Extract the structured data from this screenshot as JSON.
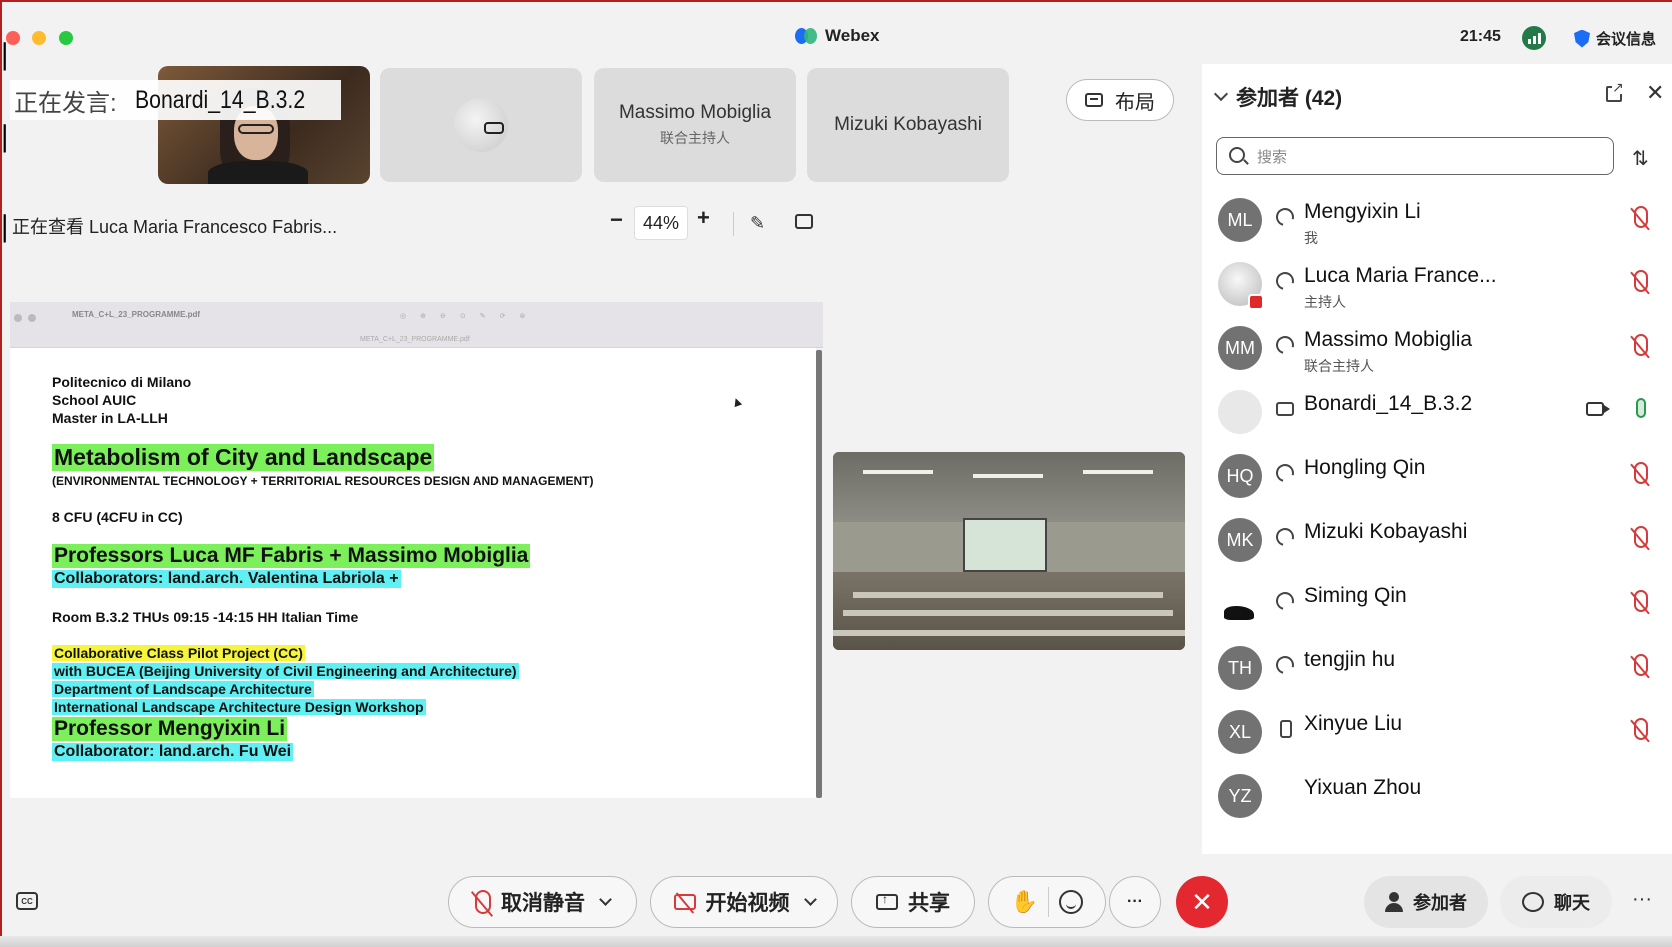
{
  "window": {
    "app_title": "Webex",
    "clock": "21:45",
    "meeting_info": "会议信息"
  },
  "stage": {
    "speaking_prefix": "正在发言:",
    "speaking_name": "Bonardi_14_B.3.2",
    "tiles": [
      {
        "name": "",
        "role": ""
      },
      {
        "name": "Massimo Mobiglia",
        "role": "联合主持人"
      },
      {
        "name": "Mizuki Kobayashi",
        "role": ""
      }
    ],
    "layout_label": "布局",
    "viewing_text": "正在查看 Luca Maria Francesco Fabris...",
    "zoom_minus": "−",
    "zoom_value": "44%",
    "zoom_plus": "+"
  },
  "document": {
    "filename": "META_C+L_23_PROGRAMME.pdf",
    "subtitle": "META_C+L_23_PROGRAMME.pdf",
    "lines": {
      "l1": "Politecnico di Milano",
      "l2": "School AUIC",
      "l3": "Master in LA-LLH",
      "title": "Metabolism of City and Landscape",
      "subtitle": "(ENVIRONMENTAL TECHNOLOGY + TERRITORIAL RESOURCES DESIGN AND MANAGEMENT)",
      "cfu": "8 CFU (4CFU in CC)",
      "professors": "Professors Luca MF Fabris + Massimo Mobiglia",
      "collab1": "Collaborators: land.arch. Valentina Labriola +",
      "room": "Room B.3.2 THUs 09:15 -14:15 HH Italian Time",
      "cc": "Collaborative Class Pilot Project (CC)",
      "bucea": "with BUCEA (Beijing University of Civil Engineering and Architecture)",
      "dept": "Department of Landscape Architecture",
      "workshop": "International Landscape Architecture Design Workshop",
      "prof2": "Professor Mengyixin Li",
      "collab2": "Collaborator: land.arch. Fu Wei"
    }
  },
  "participants_panel": {
    "title": "参加者 (42)",
    "search_placeholder": "搜索",
    "participants": [
      {
        "initials": "ML",
        "name": "Mengyixin Li",
        "role": "我",
        "audio": "muted"
      },
      {
        "initials": "",
        "name": "Luca Maria France...",
        "role": "主持人",
        "audio": "muted"
      },
      {
        "initials": "MM",
        "name": "Massimo Mobiglia",
        "role": "联合主持人",
        "audio": "muted"
      },
      {
        "initials": "",
        "name": "Bonardi_14_B.3.2",
        "role": "",
        "audio": "on"
      },
      {
        "initials": "HQ",
        "name": "Hongling Qin",
        "role": "",
        "audio": "muted"
      },
      {
        "initials": "MK",
        "name": "Mizuki Kobayashi",
        "role": "",
        "audio": "muted"
      },
      {
        "initials": "",
        "name": "Siming Qin",
        "role": "",
        "audio": "muted"
      },
      {
        "initials": "TH",
        "name": "tengjin hu",
        "role": "",
        "audio": "muted"
      },
      {
        "initials": "XL",
        "name": "Xinyue Liu",
        "role": "",
        "audio": "muted"
      },
      {
        "initials": "YZ",
        "name": "Yixuan Zhou",
        "role": "",
        "audio": "none"
      }
    ]
  },
  "controls": {
    "cc_label": "CC",
    "mute_label": "取消静音",
    "video_label": "开始视频",
    "share_label": "共享",
    "more_label": "···",
    "leave_label": "✕",
    "participants_label": "参加者",
    "chat_label": "聊天",
    "more_right_label": "···"
  },
  "colors": {
    "accent_green": "#7cf05a",
    "accent_cyan": "#5ff0f3",
    "accent_yellow": "#f6f53b",
    "leave_red": "#e3292f",
    "muted_red": "#d63a3a"
  }
}
